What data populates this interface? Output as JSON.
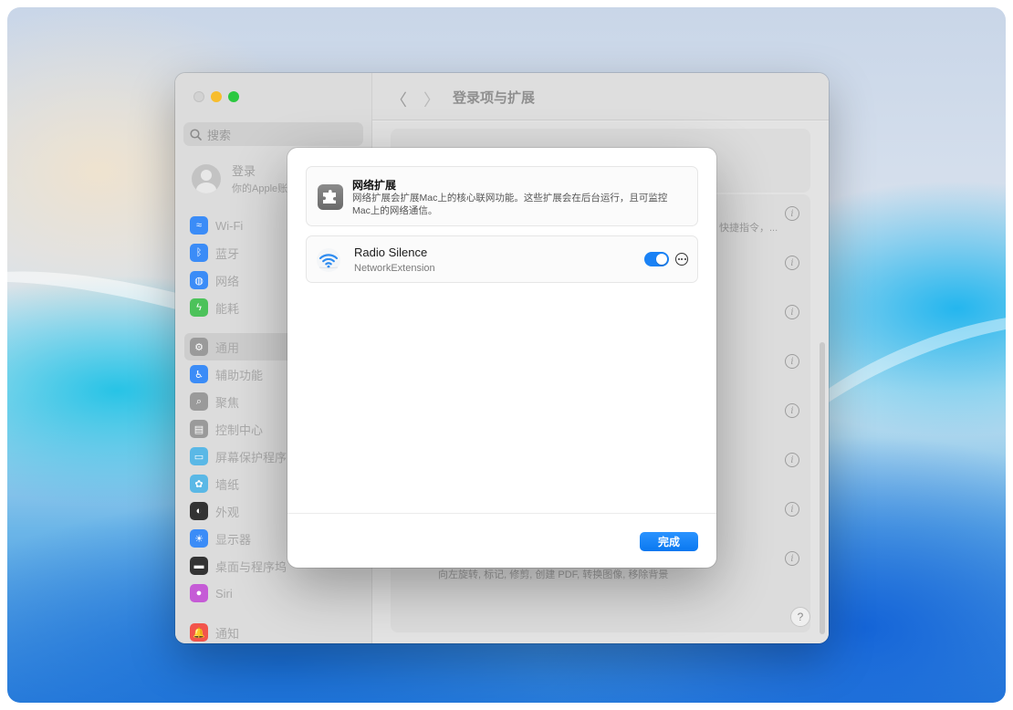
{
  "window": {
    "title": "登录项与扩展",
    "search_placeholder": "搜索",
    "account": {
      "name": "登录",
      "sub": "你的Apple账"
    },
    "sidebar_items": [
      {
        "label": "Wi-Fi",
        "icon": "wifi-icon",
        "color": "#3b8cf7"
      },
      {
        "label": "蓝牙",
        "icon": "bluetooth-icon",
        "color": "#3b8cf7"
      },
      {
        "label": "网络",
        "icon": "globe-icon",
        "color": "#3b8cf7"
      },
      {
        "label": "能耗",
        "icon": "battery-icon",
        "color": "#4cc25a"
      },
      {
        "label": "通用",
        "icon": "gear-icon",
        "color": "#9a9a9a",
        "selected": true
      },
      {
        "label": "辅助功能",
        "icon": "accessibility-icon",
        "color": "#3b8cf7"
      },
      {
        "label": "聚焦",
        "icon": "spotlight-icon",
        "color": "#9a9a9a"
      },
      {
        "label": "控制中心",
        "icon": "control-center-icon",
        "color": "#9a9a9a"
      },
      {
        "label": "屏幕保护程序",
        "icon": "screensaver-icon",
        "color": "#5ab8e6"
      },
      {
        "label": "墙纸",
        "icon": "wallpaper-icon",
        "color": "#5ab8e6"
      },
      {
        "label": "外观",
        "icon": "appearance-icon",
        "color": "#333333"
      },
      {
        "label": "显示器",
        "icon": "display-icon",
        "color": "#3b8cf7"
      },
      {
        "label": "桌面与程序坞",
        "icon": "dock-icon",
        "color": "#333333"
      },
      {
        "label": "Siri",
        "icon": "siri-icon",
        "color": "#c55bd6"
      },
      {
        "label": "通知",
        "icon": "notification-icon",
        "color": "#f2544b"
      }
    ],
    "content_rows": {
      "row1_sub": "快捷指令，...",
      "row_last_sub": "向左旋转, 标记, 修剪, 创建 PDF, 转换图像, 移除背景"
    },
    "help_label": "?"
  },
  "sheet": {
    "header_title": "网络扩展",
    "header_desc": "网络扩展会扩展Mac上的核心联网功能。这些扩展会在后台运行，且可监控Mac上的网络通信。",
    "extensions": [
      {
        "name": "Radio Silence",
        "type": "NetworkExtension",
        "enabled": true
      }
    ],
    "done_label": "完成"
  },
  "colors": {
    "accent": "#0a78f0",
    "toggle_on": "#1a82f5"
  }
}
